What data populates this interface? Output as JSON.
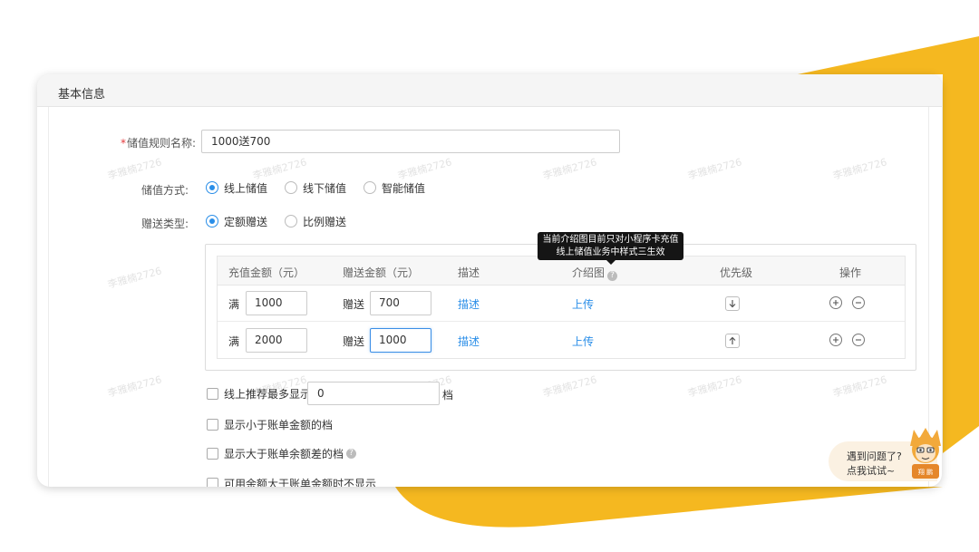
{
  "colors": {
    "accent": "#F5B820",
    "link": "#2A8EE8",
    "required": "#E4393C"
  },
  "section": {
    "title": "基本信息"
  },
  "form": {
    "rule_name": {
      "label": "储值规则名称:",
      "required_mark": "*",
      "value": "1000送700"
    },
    "method": {
      "label": "储值方式:",
      "options": [
        "线上储值",
        "线下储值",
        "智能储值"
      ],
      "selected": "线上储值"
    },
    "gift_type": {
      "label": "赠送类型:",
      "options": [
        "定额赠送",
        "比例赠送"
      ],
      "selected": "定额赠送"
    }
  },
  "table": {
    "headers": {
      "recharge": "充值金额（元）",
      "gift": "赠送金额（元）",
      "desc": "描述",
      "image": "介绍图",
      "priority": "优先级",
      "action": "操作"
    },
    "rows": [
      {
        "prefix": "满",
        "recharge": "1000",
        "gift_prefix": "赠送",
        "gift": "700",
        "desc_link": "描述",
        "upload_link": "上传",
        "priority_icon": "arrow-down-icon"
      },
      {
        "prefix": "满",
        "recharge": "2000",
        "gift_prefix": "赠送",
        "gift": "1000",
        "desc_link": "描述",
        "upload_link": "上传",
        "priority_icon": "arrow-up-icon"
      }
    ]
  },
  "tooltip": {
    "line1": "当前介绍图目前只对小程序卡充值",
    "line2": "线上储值业务中样式三生效"
  },
  "options": {
    "max_display": {
      "label": "线上推荐最多显示",
      "value": "0",
      "suffix": "档"
    },
    "show_less": {
      "label": "显示小于账单金额的档"
    },
    "show_greater": {
      "label": "显示大于账单余额差的档"
    },
    "hide_when": {
      "label": "可用余额大于账单金额时不显示"
    }
  },
  "help": {
    "line1": "遇到问题了?",
    "line2": "点我试试~",
    "mascot_caption": "翔 鹏"
  },
  "watermark": "李雅楠2726"
}
